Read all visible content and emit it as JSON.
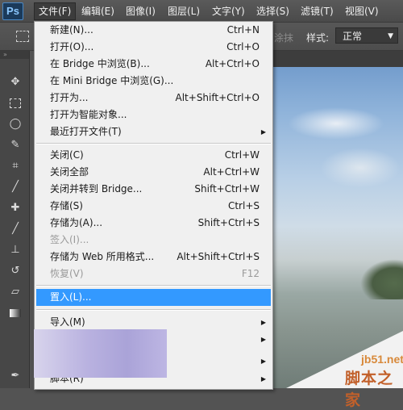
{
  "app": {
    "logo": "Ps"
  },
  "menubar": {
    "items": [
      {
        "label": "文件(F)"
      },
      {
        "label": "编辑(E)"
      },
      {
        "label": "图像(I)"
      },
      {
        "label": "图层(L)"
      },
      {
        "label": "文字(Y)"
      },
      {
        "label": "选择(S)"
      },
      {
        "label": "滤镜(T)"
      },
      {
        "label": "视图(V)"
      }
    ]
  },
  "options_bar": {
    "faded_text": "涂抹",
    "style_label": "样式:",
    "style_value": "正常"
  },
  "file_menu": {
    "items": [
      {
        "label": "新建(N)...",
        "shortcut": "Ctrl+N"
      },
      {
        "label": "打开(O)...",
        "shortcut": "Ctrl+O"
      },
      {
        "label": "在 Bridge 中浏览(B)...",
        "shortcut": "Alt+Ctrl+O"
      },
      {
        "label": "在 Mini Bridge 中浏览(G)...",
        "shortcut": ""
      },
      {
        "label": "打开为...",
        "shortcut": "Alt+Shift+Ctrl+O"
      },
      {
        "label": "打开为智能对象...",
        "shortcut": ""
      },
      {
        "label": "最近打开文件(T)",
        "shortcut": ""
      },
      {
        "label": "关闭(C)",
        "shortcut": "Ctrl+W"
      },
      {
        "label": "关闭全部",
        "shortcut": "Alt+Ctrl+W"
      },
      {
        "label": "关闭并转到 Bridge...",
        "shortcut": "Shift+Ctrl+W"
      },
      {
        "label": "存储(S)",
        "shortcut": "Ctrl+S"
      },
      {
        "label": "存储为(A)...",
        "shortcut": "Shift+Ctrl+S"
      },
      {
        "label": "签入(I)...",
        "shortcut": ""
      },
      {
        "label": "存储为 Web 所用格式...",
        "shortcut": "Alt+Shift+Ctrl+S"
      },
      {
        "label": "恢复(V)",
        "shortcut": "F12"
      },
      {
        "label": "置入(L)...",
        "shortcut": ""
      },
      {
        "label": "导入(M)",
        "shortcut": ""
      },
      {
        "label": "脚本(R)",
        "shortcut": ""
      }
    ]
  },
  "watermark": {
    "url": "jb51.net",
    "name": "脚本之家"
  },
  "colors": {
    "selection": "#3399ff",
    "menu_bg": "#f0f0f0",
    "ui_bg": "#535353"
  }
}
